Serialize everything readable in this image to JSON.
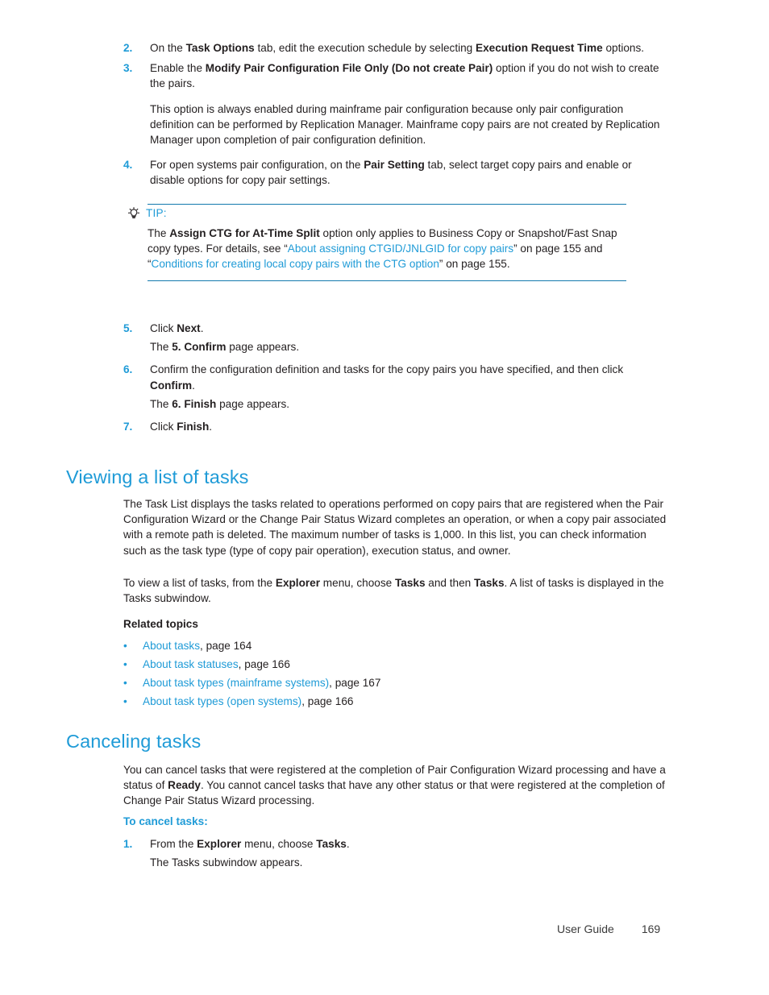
{
  "page": {
    "footer_label": "User Guide",
    "footer_page_number": "169"
  },
  "colors": {
    "accent_blue": "#1f9bd7",
    "rule_blue": "#1379ad",
    "text": "#231f20"
  },
  "steps_top": [
    {
      "number": "2.",
      "parts": [
        {
          "t": "On the ",
          "s": "normal"
        },
        {
          "t": "Task Options",
          "s": "bold"
        },
        {
          "t": " tab, edit the execution schedule by selecting ",
          "s": "normal"
        },
        {
          "t": "Execution Request Time",
          "s": "bold"
        },
        {
          "t": " options.",
          "s": "normal"
        }
      ]
    },
    {
      "number": "3.",
      "parts": [
        {
          "t": "Enable the ",
          "s": "normal"
        },
        {
          "t": "Modify Pair Configuration File Only (Do not create Pair)",
          "s": "bold"
        },
        {
          "t": " option if you do not wish to create the pairs.",
          "s": "normal"
        }
      ]
    }
  ],
  "note_paragraph": "This option is always enabled during mainframe pair configuration because only pair configuration definition can be performed by Replication Manager. Mainframe copy pairs are not created by Replication Manager upon completion of pair configuration definition.",
  "step_four": {
    "number": "4.",
    "parts": [
      {
        "t": "For open systems pair configuration, on the ",
        "s": "normal"
      },
      {
        "t": "Pair Setting",
        "s": "bold"
      },
      {
        "t": " tab, select target copy pairs and enable or disable options for copy pair settings.",
        "s": "normal"
      }
    ]
  },
  "tip": {
    "icon": "lightbulb-icon",
    "label": "TIP:",
    "parts": [
      {
        "t": "The ",
        "s": "normal"
      },
      {
        "t": "Assign CTG  for At-Time Split",
        "s": "bold"
      },
      {
        "t": " option only applies to Business Copy or Snapshot/Fast Snap copy types. For details, see “",
        "s": "normal"
      },
      {
        "t": "About assigning CTGID/JNLGID for copy pairs",
        "s": "link"
      },
      {
        "t": "” on page 155 and “",
        "s": "normal"
      },
      {
        "t": "Conditions for creating local copy pairs with the CTG option",
        "s": "link"
      },
      {
        "t": "” on page 155.",
        "s": "normal"
      }
    ]
  },
  "steps_bottom": [
    {
      "number": "5.",
      "parts": [
        {
          "t": "Click ",
          "s": "normal"
        },
        {
          "t": "Next",
          "s": "bold"
        },
        {
          "t": ".",
          "s": "normal"
        }
      ],
      "follow": [
        {
          "t": "The ",
          "s": "normal"
        },
        {
          "t": "5. Confirm",
          "s": "bold"
        },
        {
          "t": " page appears.",
          "s": "normal"
        }
      ]
    },
    {
      "number": "6.",
      "parts": [
        {
          "t": "Confirm the configuration definition and tasks for the copy pairs you have specified, and then click ",
          "s": "normal"
        },
        {
          "t": "Confirm",
          "s": "bold"
        },
        {
          "t": ".",
          "s": "normal"
        }
      ],
      "follow": [
        {
          "t": "The ",
          "s": "normal"
        },
        {
          "t": "6. Finish",
          "s": "bold"
        },
        {
          "t": " page appears.",
          "s": "normal"
        }
      ]
    },
    {
      "number": "7.",
      "parts": [
        {
          "t": "Click ",
          "s": "normal"
        },
        {
          "t": "Finish",
          "s": "bold"
        },
        {
          "t": ".",
          "s": "normal"
        }
      ],
      "follow": null
    }
  ],
  "section_viewing": {
    "heading": "Viewing a list of tasks",
    "paragraph1": "The Task List displays the tasks related to operations performed on copy pairs that are registered when the Pair Configuration Wizard or the Change Pair Status Wizard completes an operation, or when a copy pair associated with a remote path is deleted. The maximum number of tasks is 1,000.  In this list, you can check information such as the task type (type of copy pair operation), execution status, and owner.",
    "paragraph2_parts": [
      {
        "t": "To view a list of tasks, from the ",
        "s": "normal"
      },
      {
        "t": "Explorer",
        "s": "bold"
      },
      {
        "t": " menu, choose ",
        "s": "normal"
      },
      {
        "t": "Tasks",
        "s": "bold"
      },
      {
        "t": " and then ",
        "s": "normal"
      },
      {
        "t": "Tasks",
        "s": "bold"
      },
      {
        "t": ". A list of tasks is displayed in the Tasks subwindow.",
        "s": "normal"
      }
    ],
    "related_topics_heading": "Related topics",
    "related_topics": [
      {
        "link": "About tasks",
        "suffix": ", page 164"
      },
      {
        "link": "About task statuses",
        "suffix": ", page 166"
      },
      {
        "link": "About task types (mainframe systems)",
        "suffix": ", page 167"
      },
      {
        "link": "About task types (open systems)",
        "suffix": ", page 166"
      }
    ]
  },
  "section_canceling": {
    "heading": "Canceling tasks",
    "paragraph_parts": [
      {
        "t": "You can cancel tasks that were registered at the completion of Pair Configuration Wizard processing and have a status of ",
        "s": "normal"
      },
      {
        "t": "Ready",
        "s": "bold"
      },
      {
        "t": ". You cannot cancel tasks that have any other status or that were registered at the completion of Change Pair Status Wizard processing.",
        "s": "normal"
      }
    ],
    "procedure_heading": "To cancel tasks:",
    "steps": [
      {
        "number": "1.",
        "parts": [
          {
            "t": "From the ",
            "s": "normal"
          },
          {
            "t": "Explorer",
            "s": "bold"
          },
          {
            "t": " menu, choose ",
            "s": "normal"
          },
          {
            "t": "Tasks",
            "s": "bold"
          },
          {
            "t": ".",
            "s": "normal"
          }
        ],
        "follow": [
          {
            "t": "The Tasks subwindow appears.",
            "s": "normal"
          }
        ]
      }
    ]
  }
}
